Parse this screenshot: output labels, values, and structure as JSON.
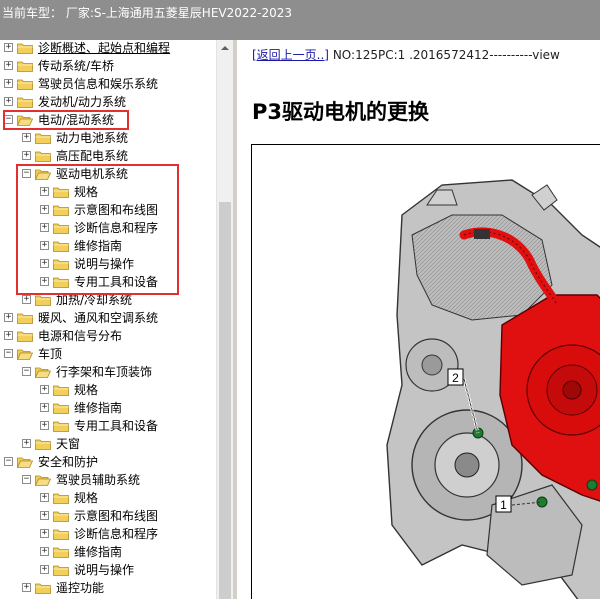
{
  "titlebar": {
    "text": "当前车型： 厂家:S-上海通用五菱星辰HEV2022-2023"
  },
  "tree": {
    "items": [
      {
        "level": 0,
        "expander": "+",
        "label": "诊断概述、起始点和编程",
        "link": true
      },
      {
        "level": 0,
        "expander": "+",
        "label": "传动系统/车桥"
      },
      {
        "level": 0,
        "expander": "+",
        "label": "驾驶员信息和娱乐系统"
      },
      {
        "level": 0,
        "expander": "+",
        "label": "发动机/动力系统"
      },
      {
        "level": 0,
        "expander": "−",
        "label": "电动/混动系统",
        "open": true
      },
      {
        "level": 1,
        "expander": "+",
        "label": "动力电池系统"
      },
      {
        "level": 1,
        "expander": "+",
        "label": "高压配电系统"
      },
      {
        "level": 1,
        "expander": "−",
        "label": "驱动电机系统",
        "open": true
      },
      {
        "level": 2,
        "expander": "+",
        "label": "规格"
      },
      {
        "level": 2,
        "expander": "+",
        "label": "示意图和布线图"
      },
      {
        "level": 2,
        "expander": "+",
        "label": "诊断信息和程序"
      },
      {
        "level": 2,
        "expander": "+",
        "label": "维修指南"
      },
      {
        "level": 2,
        "expander": "+",
        "label": "说明与操作"
      },
      {
        "level": 2,
        "expander": "+",
        "label": "专用工具和设备"
      },
      {
        "level": 1,
        "expander": "+",
        "label": "加热/冷却系统"
      },
      {
        "level": 0,
        "expander": "+",
        "label": "暖风、通风和空调系统"
      },
      {
        "level": 0,
        "expander": "+",
        "label": "电源和信号分布"
      },
      {
        "level": 0,
        "expander": "−",
        "label": "车顶",
        "open": true
      },
      {
        "level": 1,
        "expander": "−",
        "label": "行李架和车顶装饰",
        "open": true
      },
      {
        "level": 2,
        "expander": "+",
        "label": "规格"
      },
      {
        "level": 2,
        "expander": "+",
        "label": "维修指南"
      },
      {
        "level": 2,
        "expander": "+",
        "label": "专用工具和设备"
      },
      {
        "level": 1,
        "expander": "+",
        "label": "天窗"
      },
      {
        "level": 0,
        "expander": "−",
        "label": "安全和防护",
        "open": true
      },
      {
        "level": 1,
        "expander": "−",
        "label": "驾驶员辅助系统",
        "open": true
      },
      {
        "level": 2,
        "expander": "+",
        "label": "规格"
      },
      {
        "level": 2,
        "expander": "+",
        "label": "示意图和布线图"
      },
      {
        "level": 2,
        "expander": "+",
        "label": "诊断信息和程序"
      },
      {
        "level": 2,
        "expander": "+",
        "label": "维修指南"
      },
      {
        "level": 2,
        "expander": "+",
        "label": "说明与操作"
      },
      {
        "level": 1,
        "expander": "+",
        "label": "遥控功能"
      }
    ]
  },
  "content": {
    "back_link": "[返回上一页..]",
    "record_info": " NO:125PC:1 .2016572412----------view",
    "title": "P3驱动电机的更换",
    "callout_1": "1",
    "callout_2": "2"
  },
  "colors": {
    "titlebar_bg": "#8e8e8e",
    "highlight": "#e03030",
    "motor_red": "#e01010",
    "folder_yellow": "#f2cf5b",
    "link_blue": "#1a1aa6"
  }
}
